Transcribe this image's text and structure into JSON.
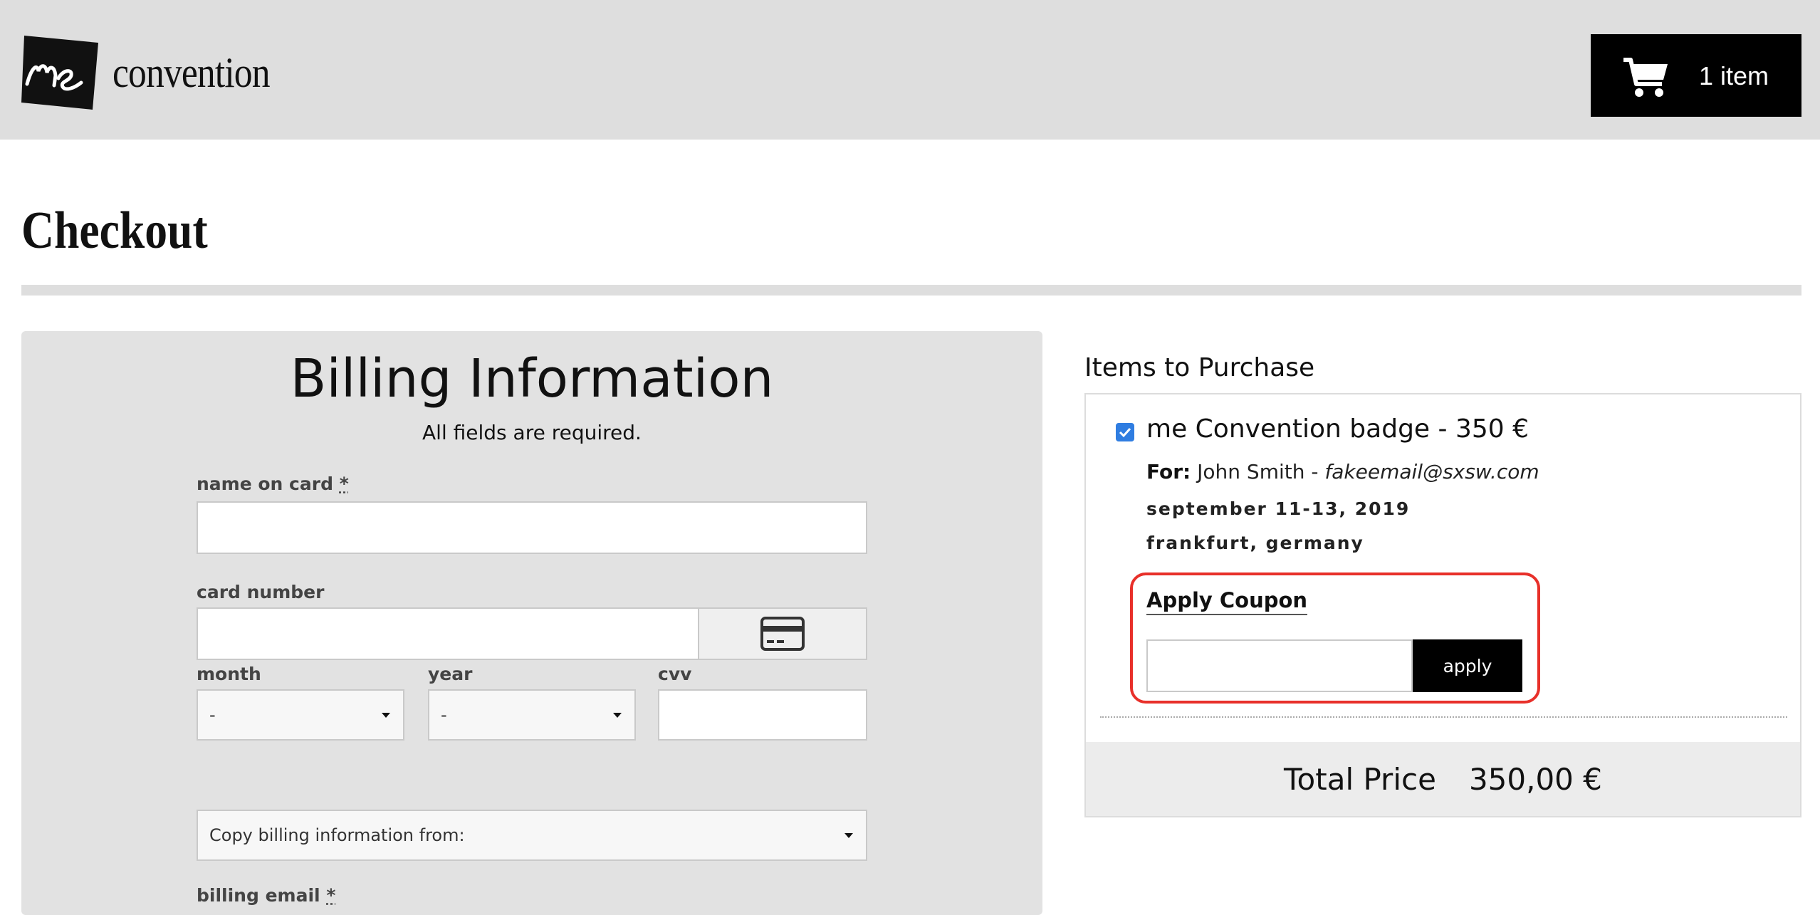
{
  "header": {
    "logo_text": "convention",
    "cart_label": "1 item"
  },
  "page": {
    "title": "Checkout"
  },
  "billing": {
    "title": "Billing Information",
    "subtitle": "All fields are required.",
    "name_label": "name on card",
    "name_required_mark": "*",
    "name_value": "",
    "card_number_label": "card number",
    "card_number_value": "",
    "month_label": "month",
    "month_value": "-",
    "year_label": "year",
    "year_value": "-",
    "cvv_label": "cvv",
    "cvv_value": "",
    "copy_from_value": "Copy billing information from:",
    "billing_email_label": "billing email",
    "billing_email_required_mark": "*"
  },
  "items": {
    "heading": "Items to Purchase",
    "list": [
      {
        "checked": true,
        "name": "me Convention badge - 350 €",
        "for_label": "For:",
        "for_name": "John Smith",
        "for_sep": " - ",
        "for_email": "fakeemail@sxsw.com",
        "date": "september 11-13, 2019",
        "location": "frankfurt, germany"
      }
    ],
    "coupon": {
      "title": "Apply Coupon",
      "value": "",
      "button_label": "apply"
    },
    "total_label": "Total Price",
    "total_value": "350,00 €"
  },
  "colors": {
    "header_bg": "#dedede",
    "panel_bg": "#e2e2e2",
    "accent_black": "#000000",
    "checkbox_blue": "#2f7de1",
    "highlight_red": "#e8302a"
  }
}
